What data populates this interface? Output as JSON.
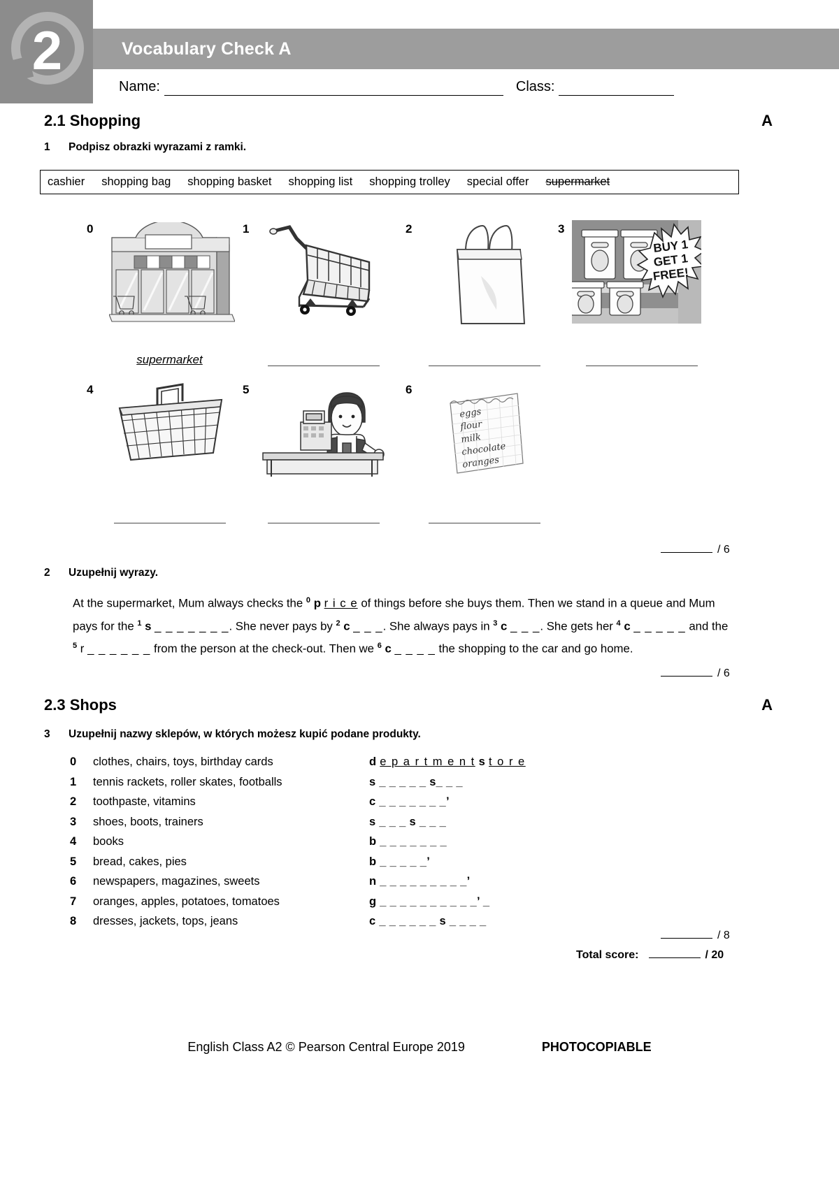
{
  "header": {
    "unit_number": "2",
    "title": "Vocabulary Check A",
    "name_label": "Name:",
    "class_label": "Class:"
  },
  "sections": [
    {
      "id": "2.1",
      "heading": "2.1 Shopping",
      "letter": "A"
    },
    {
      "id": "2.3",
      "heading": "2.3 Shops",
      "letter": "A"
    }
  ],
  "exercise1": {
    "number": "1",
    "instruction": "Podpisz obrazki wyrazami z ramki.",
    "wordbank": [
      {
        "word": "cashier",
        "used": false
      },
      {
        "word": "shopping bag",
        "used": false
      },
      {
        "word": "shopping basket",
        "used": false
      },
      {
        "word": "shopping list",
        "used": false
      },
      {
        "word": "shopping trolley",
        "used": false
      },
      {
        "word": "special offer",
        "used": false
      },
      {
        "word": "supermarket",
        "used": true
      }
    ],
    "pictures": [
      {
        "index": "0",
        "icon": "supermarket-storefront-icon",
        "answer": "supermarket"
      },
      {
        "index": "1",
        "icon": "shopping-trolley-icon",
        "answer": ""
      },
      {
        "index": "2",
        "icon": "shopping-bag-icon",
        "answer": ""
      },
      {
        "index": "3",
        "icon": "special-offer-shelf-icon",
        "answer": ""
      },
      {
        "index": "4",
        "icon": "shopping-basket-icon",
        "answer": ""
      },
      {
        "index": "5",
        "icon": "cashier-icon",
        "answer": ""
      },
      {
        "index": "6",
        "icon": "shopping-list-icon",
        "answer": ""
      }
    ],
    "offer_sign": {
      "line1": "BUY 1",
      "line2": "GET 1",
      "line3": "FREE!"
    },
    "shopping_list_items": [
      "eggs",
      "flour",
      "milk",
      "chocolate",
      "oranges"
    ],
    "score_max": "/ 6"
  },
  "exercise2": {
    "number": "2",
    "instruction": "Uzupełnij wyrazy.",
    "text_parts": {
      "t0": "At the supermarket, Mum always checks the ",
      "n0": "0",
      "a0_bold": "p",
      "a0_letters": "r i c e",
      "t1": " of things before she buys them. Then we stand in a queue and Mum pays for the ",
      "n1": "1",
      "a1_bold": "s",
      "a1_gap": "_ _ _ _ _ _ _",
      "t2": ". She never pays by ",
      "n2": "2",
      "a2_bold": "c",
      "a2_gap": "_ _ _",
      "t3": ". She always pays in ",
      "n3": "3",
      "a3_bold": "c",
      "a3_gap": "_ _ _",
      "t4": ". She gets her ",
      "n4": "4",
      "a4_bold": "c",
      "a4_gap": "_ _ _ _ _",
      "t5": " and the ",
      "n5": "5",
      "a5_bold": "r",
      "a5_gap": "_ _ _ _ _ _",
      "t6": " from the person at the check-out. Then we ",
      "n6": "6",
      "a6_bold": "c",
      "a6_gap": "_ _ _ _",
      "t7": " the shopping to the car and go home."
    },
    "score_max": "/ 6"
  },
  "exercise3": {
    "number": "3",
    "instruction": "Uzupełnij nazwy sklepów, w których możesz kupić podane produkty.",
    "rows": [
      {
        "n": "0",
        "items": "clothes, chairs, toys, birthday cards",
        "answer_first": "d",
        "answer_letters": "e p a r t m e n t",
        "answer_second": "s",
        "answer_letters2": "t o r e"
      },
      {
        "n": "1",
        "items": "tennis rackets, roller skates, footballs",
        "answer_first": "s",
        "answer_gap": "_ _ _ _ _",
        "answer_second": "s",
        "answer_gap2": "_ _ _"
      },
      {
        "n": "2",
        "items": "toothpaste, vitamins",
        "answer_first": "c",
        "answer_gap": "_ _ _ _ _ _ _",
        "answer_apos": "’"
      },
      {
        "n": "3",
        "items": "shoes, boots, trainers",
        "answer_first": "s",
        "answer_gap": "_ _ _",
        "answer_second": "s",
        "answer_gap2": "_ _ _"
      },
      {
        "n": "4",
        "items": "books",
        "answer_first": "b",
        "answer_gap": "_ _ _ _ _ _ _"
      },
      {
        "n": "5",
        "items": "bread, cakes, pies",
        "answer_first": "b",
        "answer_gap": "_ _ _ _ _",
        "answer_apos": "’"
      },
      {
        "n": "6",
        "items": "newspapers, magazines, sweets",
        "answer_first": "n",
        "answer_gap": "_ _ _ _ _ _ _ _ _",
        "answer_apos": "’"
      },
      {
        "n": "7",
        "items": "oranges, apples, potatoes, tomatoes",
        "answer_first": "g",
        "answer_gap": "_ _ _ _ _ _ _ _ _ _",
        "answer_apos": "’",
        "answer_tail": "_"
      },
      {
        "n": "8",
        "items": "dresses, jackets, tops, jeans",
        "answer_first": "c",
        "answer_gap": "_ _ _ _ _ _",
        "answer_second": "s",
        "answer_gap2": "_ _ _ _"
      }
    ],
    "score_max": "/ 8"
  },
  "total": {
    "label": "Total score:",
    "max": "/ 20"
  },
  "footer": {
    "credit": "English Class A2 © Pearson Central Europe 2019",
    "photocopiable": "PHOTOCOPIABLE"
  },
  "colors": {
    "header_gray": "#9d9d9d",
    "badge_gray": "#8c8c8c",
    "ring_gray": "#b3b3b3",
    "line_gray": "#4a4a4a"
  }
}
